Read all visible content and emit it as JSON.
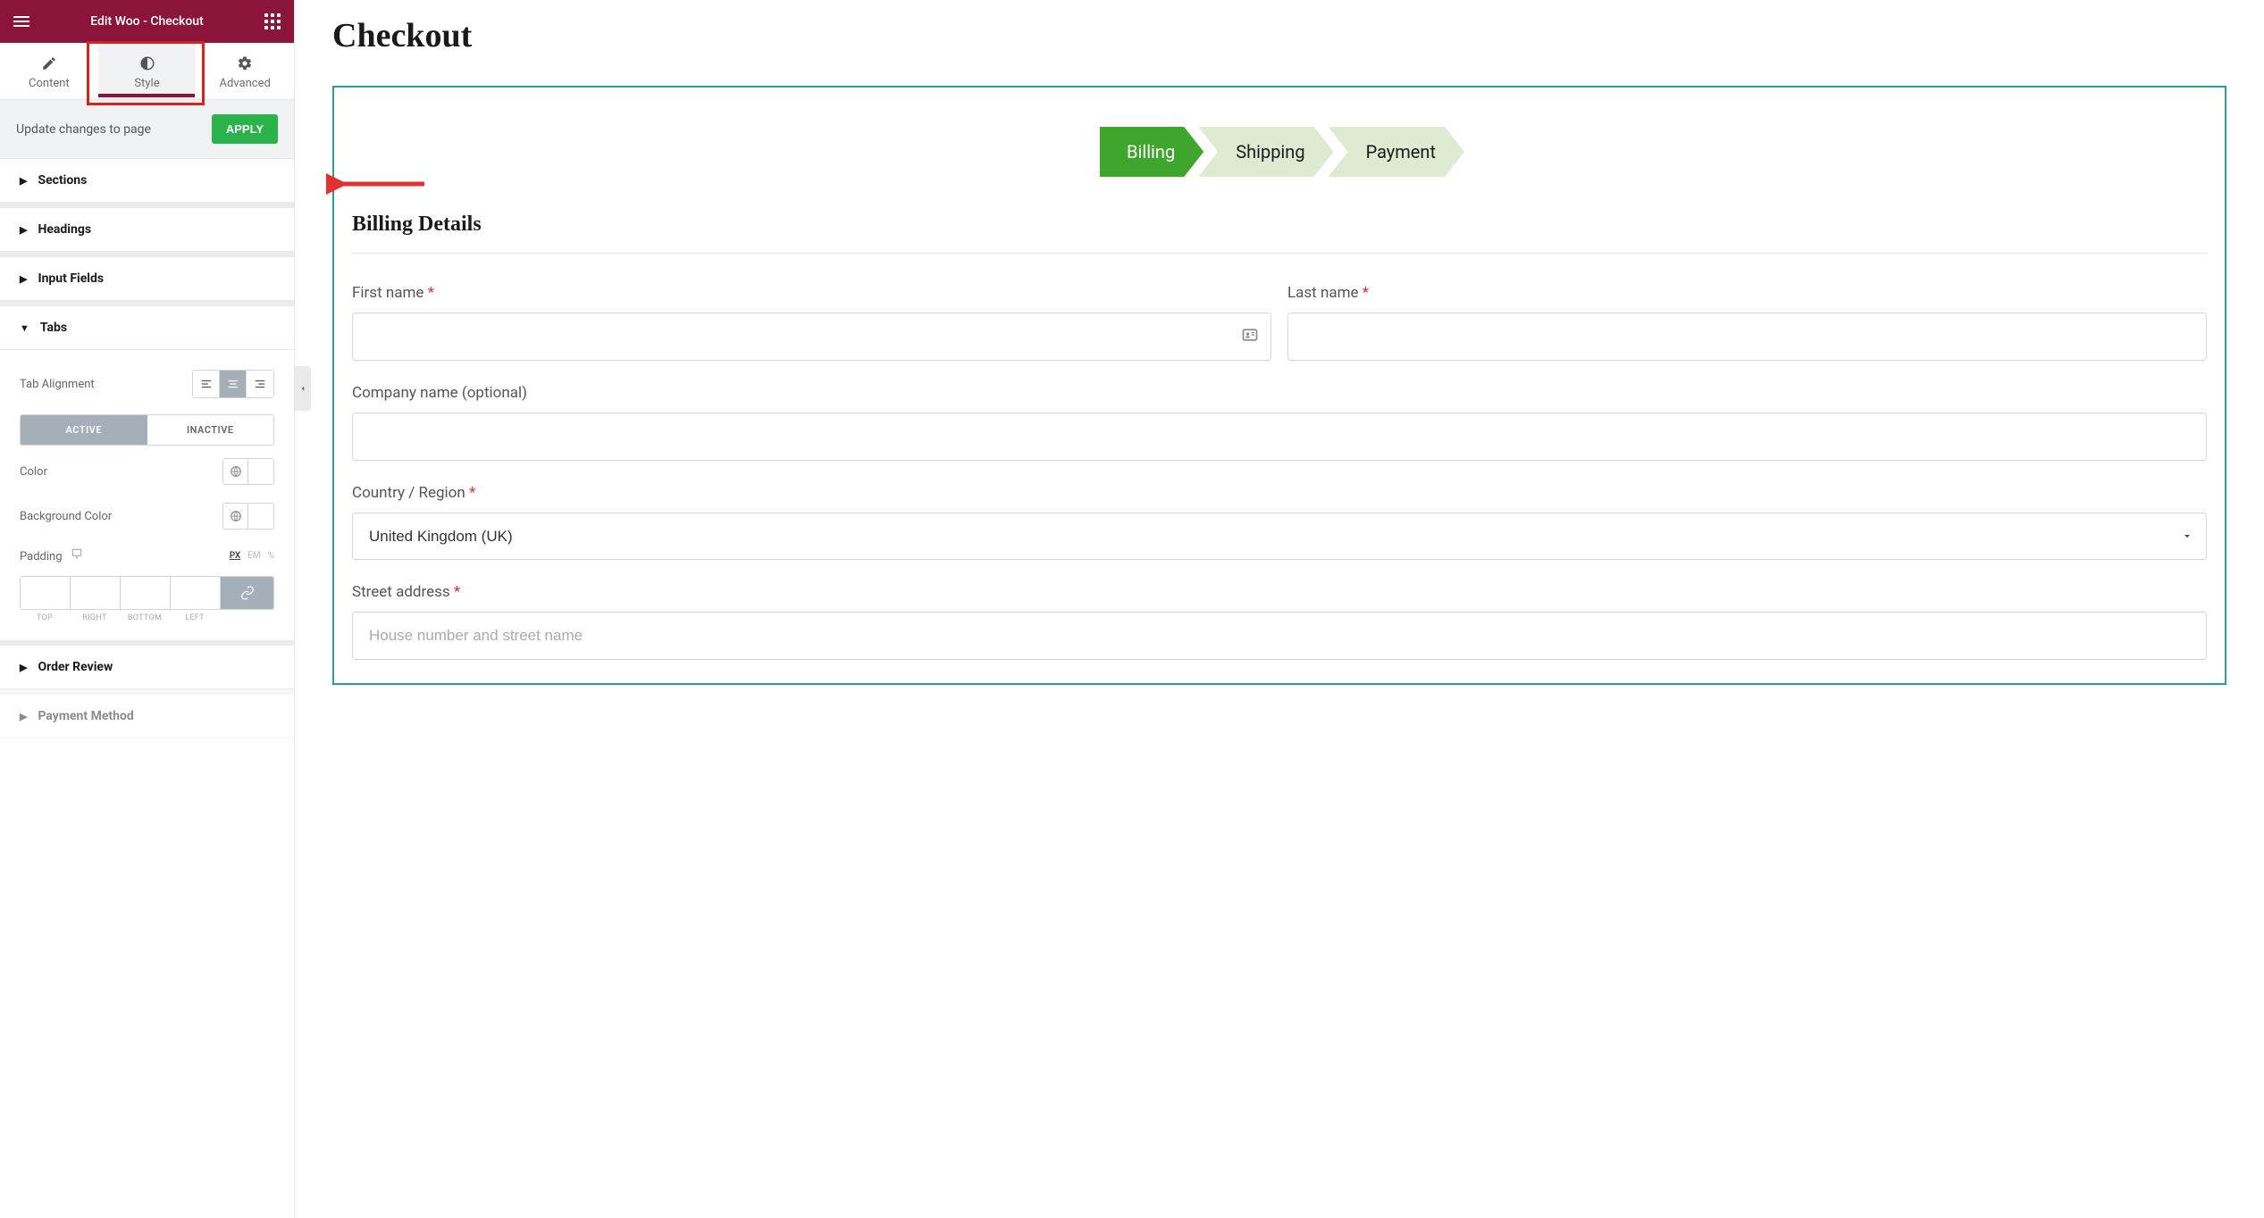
{
  "sidebar": {
    "title": "Edit Woo - Checkout",
    "tabs": {
      "content": "Content",
      "style": "Style",
      "advanced": "Advanced"
    },
    "update_label": "Update changes to page",
    "apply_label": "APPLY",
    "sections": {
      "sections": "Sections",
      "headings": "Headings",
      "input_fields": "Input Fields",
      "tabs": "Tabs",
      "order_review": "Order Review",
      "payment_method": "Payment Method"
    },
    "tabs_panel": {
      "tab_alignment": "Tab Alignment",
      "state_active": "ACTIVE",
      "state_inactive": "INACTIVE",
      "color": "Color",
      "background_color": "Background Color",
      "padding": "Padding",
      "units": {
        "px": "PX",
        "em": "EM",
        "pct": "%"
      },
      "sides": {
        "top": "TOP",
        "right": "RIGHT",
        "bottom": "BOTTOM",
        "left": "LEFT"
      },
      "bg_color_value": "#3fa52c"
    }
  },
  "preview": {
    "title": "Checkout",
    "steps": {
      "billing": "Billing",
      "shipping": "Shipping",
      "payment": "Payment"
    },
    "billing_heading": "Billing Details",
    "labels": {
      "first_name": "First name",
      "last_name": "Last name",
      "company": "Company name (optional)",
      "country": "Country / Region",
      "street": "Street address"
    },
    "country_value": "United Kingdom (UK)",
    "street_placeholder": "House number and street name"
  }
}
